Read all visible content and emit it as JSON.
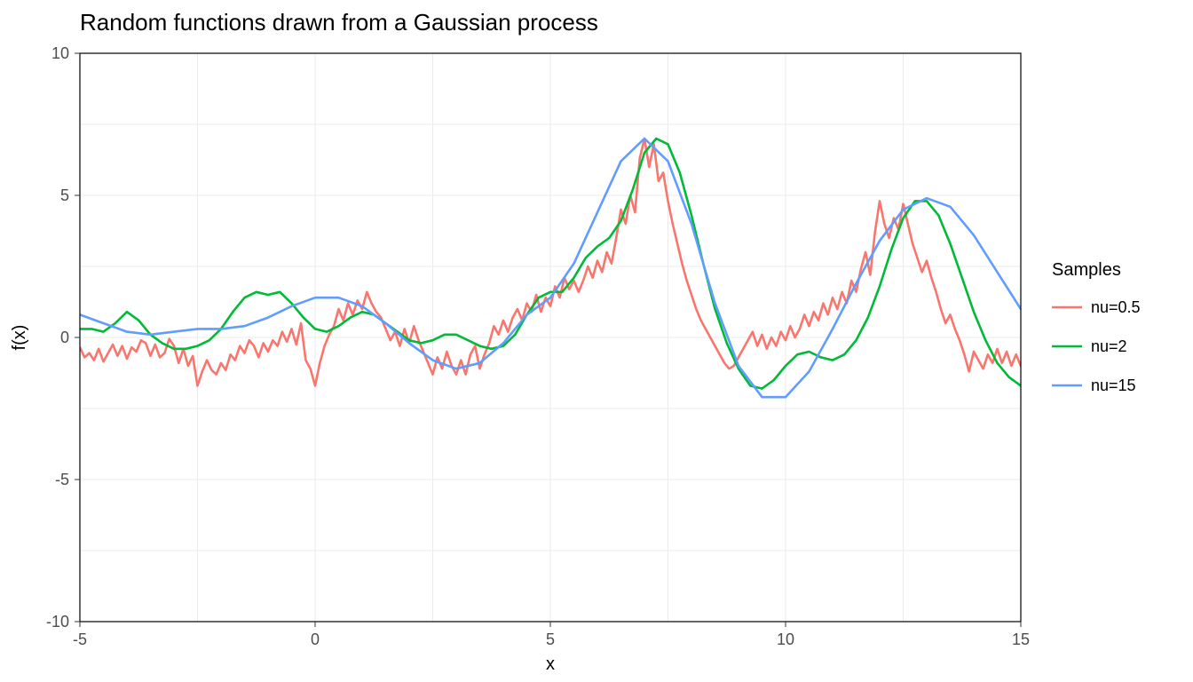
{
  "chart_data": {
    "type": "line",
    "title": "Random functions drawn from a Gaussian process",
    "xlabel": "x",
    "ylabel": "f(x)",
    "xlim": [
      -5,
      15
    ],
    "ylim": [
      -10,
      10
    ],
    "x_ticks": [
      -5,
      0,
      5,
      10,
      15
    ],
    "y_ticks": [
      -10,
      -5,
      0,
      5,
      10
    ],
    "x_grid": [
      -5,
      -2.5,
      0,
      2.5,
      5,
      7.5,
      10,
      12.5,
      15
    ],
    "y_grid": [
      -10,
      -7.5,
      -5,
      -2.5,
      0,
      2.5,
      5,
      7.5,
      10
    ],
    "legend": {
      "title": "Samples",
      "entries": [
        "nu=0.5",
        "nu=2",
        "nu=15"
      ],
      "colors": [
        "#F8766D",
        "#00BA38",
        "#619CFF"
      ]
    },
    "series": [
      {
        "name": "nu=0.5",
        "color": "#F8766D",
        "x": [
          -5.0,
          -4.9,
          -4.8,
          -4.7,
          -4.6,
          -4.5,
          -4.4,
          -4.3,
          -4.2,
          -4.1,
          -4.0,
          -3.9,
          -3.8,
          -3.7,
          -3.6,
          -3.5,
          -3.4,
          -3.3,
          -3.2,
          -3.1,
          -3.0,
          -2.9,
          -2.8,
          -2.7,
          -2.6,
          -2.5,
          -2.4,
          -2.3,
          -2.2,
          -2.1,
          -2.0,
          -1.9,
          -1.8,
          -1.7,
          -1.6,
          -1.5,
          -1.4,
          -1.3,
          -1.2,
          -1.1,
          -1.0,
          -0.9,
          -0.8,
          -0.7,
          -0.6,
          -0.5,
          -0.4,
          -0.3,
          -0.2,
          -0.1,
          0.0,
          0.1,
          0.2,
          0.3,
          0.4,
          0.5,
          0.6,
          0.7,
          0.8,
          0.9,
          1.0,
          1.1,
          1.2,
          1.3,
          1.4,
          1.5,
          1.6,
          1.7,
          1.8,
          1.9,
          2.0,
          2.1,
          2.2,
          2.3,
          2.4,
          2.5,
          2.6,
          2.7,
          2.8,
          2.9,
          3.0,
          3.1,
          3.2,
          3.3,
          3.4,
          3.5,
          3.6,
          3.7,
          3.8,
          3.9,
          4.0,
          4.1,
          4.2,
          4.3,
          4.4,
          4.5,
          4.6,
          4.7,
          4.8,
          4.9,
          5.0,
          5.1,
          5.2,
          5.3,
          5.4,
          5.5,
          5.6,
          5.7,
          5.8,
          5.9,
          6.0,
          6.1,
          6.2,
          6.3,
          6.4,
          6.5,
          6.6,
          6.7,
          6.8,
          6.9,
          7.0,
          7.1,
          7.2,
          7.3,
          7.4,
          7.5,
          7.6,
          7.7,
          7.8,
          7.9,
          8.0,
          8.1,
          8.2,
          8.3,
          8.4,
          8.5,
          8.6,
          8.7,
          8.8,
          8.9,
          9.0,
          9.1,
          9.2,
          9.3,
          9.4,
          9.5,
          9.6,
          9.7,
          9.8,
          9.9,
          10.0,
          10.1,
          10.2,
          10.3,
          10.4,
          10.5,
          10.6,
          10.7,
          10.8,
          10.9,
          11.0,
          11.1,
          11.2,
          11.3,
          11.4,
          11.5,
          11.6,
          11.7,
          11.8,
          11.9,
          12.0,
          12.1,
          12.2,
          12.3,
          12.4,
          12.5,
          12.6,
          12.7,
          12.8,
          12.9,
          13.0,
          13.1,
          13.2,
          13.3,
          13.4,
          13.5,
          13.6,
          13.7,
          13.8,
          13.9,
          14.0,
          14.1,
          14.2,
          14.3,
          14.4,
          14.5,
          14.6,
          14.7,
          14.8,
          14.9,
          15.0
        ],
        "y": [
          -0.35,
          -0.7,
          -0.55,
          -0.8,
          -0.4,
          -0.85,
          -0.55,
          -0.25,
          -0.65,
          -0.3,
          -0.75,
          -0.35,
          -0.5,
          -0.1,
          -0.2,
          -0.65,
          -0.25,
          -0.7,
          -0.55,
          -0.05,
          -0.3,
          -0.9,
          -0.4,
          -1.0,
          -0.65,
          -1.7,
          -1.2,
          -0.8,
          -1.15,
          -1.3,
          -0.9,
          -1.15,
          -0.6,
          -0.8,
          -0.3,
          -0.55,
          -0.1,
          -0.3,
          -0.7,
          -0.2,
          -0.5,
          -0.1,
          -0.3,
          0.2,
          -0.15,
          0.3,
          -0.25,
          0.5,
          -0.8,
          -1.1,
          -1.7,
          -0.9,
          -0.3,
          0.1,
          0.4,
          1.0,
          0.6,
          1.2,
          0.8,
          1.3,
          1.0,
          1.6,
          1.2,
          0.9,
          0.7,
          0.3,
          -0.1,
          0.2,
          -0.3,
          0.3,
          -0.2,
          0.4,
          -0.1,
          -0.5,
          -0.9,
          -1.3,
          -0.7,
          -1.1,
          -0.5,
          -1.0,
          -1.3,
          -0.8,
          -1.3,
          -0.6,
          -0.3,
          -1.1,
          -0.6,
          -0.2,
          0.4,
          0.1,
          0.6,
          0.2,
          0.7,
          1.0,
          0.6,
          1.2,
          0.9,
          1.5,
          0.9,
          1.4,
          1.1,
          1.8,
          1.4,
          2.1,
          1.7,
          2.0,
          1.6,
          2.0,
          2.5,
          2.1,
          2.7,
          2.3,
          3.0,
          2.6,
          3.5,
          4.5,
          4.0,
          5.0,
          4.4,
          6.3,
          7.0,
          6.0,
          6.8,
          5.5,
          5.8,
          4.8,
          4.0,
          3.3,
          2.6,
          2.0,
          1.5,
          1.0,
          0.6,
          0.3,
          0.0,
          -0.3,
          -0.6,
          -0.9,
          -1.1,
          -1.0,
          -0.7,
          -0.4,
          -0.1,
          0.2,
          -0.3,
          0.1,
          -0.4,
          0.0,
          -0.3,
          0.2,
          -0.1,
          0.4,
          0.0,
          0.3,
          0.8,
          0.4,
          0.9,
          0.6,
          1.2,
          0.8,
          1.4,
          1.0,
          1.6,
          1.2,
          2.0,
          1.6,
          2.4,
          3.0,
          2.2,
          3.7,
          4.8,
          4.0,
          3.5,
          4.2,
          3.8,
          4.7,
          4.0,
          3.3,
          2.8,
          2.3,
          2.7,
          2.1,
          1.6,
          1.0,
          0.5,
          0.8,
          0.3,
          -0.1,
          -0.6,
          -1.2,
          -0.5,
          -0.8,
          -1.1,
          -0.6,
          -0.9,
          -0.4,
          -0.9,
          -0.5,
          -1.0,
          -0.6,
          -1.0
        ]
      },
      {
        "name": "nu=2",
        "color": "#00BA38",
        "x": [
          -5.0,
          -4.75,
          -4.5,
          -4.25,
          -4.0,
          -3.75,
          -3.5,
          -3.25,
          -3.0,
          -2.75,
          -2.5,
          -2.25,
          -2.0,
          -1.75,
          -1.5,
          -1.25,
          -1.0,
          -0.75,
          -0.5,
          -0.25,
          0.0,
          0.25,
          0.5,
          0.75,
          1.0,
          1.25,
          1.5,
          1.75,
          2.0,
          2.25,
          2.5,
          2.75,
          3.0,
          3.25,
          3.5,
          3.75,
          4.0,
          4.25,
          4.5,
          4.75,
          5.0,
          5.25,
          5.5,
          5.75,
          6.0,
          6.25,
          6.5,
          6.75,
          7.0,
          7.25,
          7.5,
          7.75,
          8.0,
          8.25,
          8.5,
          8.75,
          9.0,
          9.25,
          9.5,
          9.75,
          10.0,
          10.25,
          10.5,
          10.75,
          11.0,
          11.25,
          11.5,
          11.75,
          12.0,
          12.25,
          12.5,
          12.75,
          13.0,
          13.25,
          13.5,
          13.75,
          14.0,
          14.25,
          14.5,
          14.75,
          15.0
        ],
        "y": [
          0.3,
          0.3,
          0.2,
          0.5,
          0.9,
          0.6,
          0.1,
          -0.2,
          -0.4,
          -0.4,
          -0.3,
          -0.1,
          0.3,
          0.9,
          1.4,
          1.6,
          1.5,
          1.6,
          1.2,
          0.7,
          0.3,
          0.2,
          0.4,
          0.7,
          0.9,
          0.8,
          0.5,
          0.2,
          -0.1,
          -0.2,
          -0.1,
          0.1,
          0.1,
          -0.1,
          -0.3,
          -0.4,
          -0.3,
          0.1,
          0.8,
          1.4,
          1.6,
          1.6,
          2.1,
          2.8,
          3.2,
          3.5,
          4.1,
          5.2,
          6.5,
          7.0,
          6.8,
          5.8,
          4.3,
          2.6,
          1.0,
          -0.2,
          -1.1,
          -1.7,
          -1.8,
          -1.5,
          -1.0,
          -0.6,
          -0.5,
          -0.7,
          -0.8,
          -0.6,
          -0.1,
          0.7,
          1.8,
          3.1,
          4.2,
          4.8,
          4.8,
          4.3,
          3.3,
          2.1,
          0.9,
          -0.1,
          -0.9,
          -1.4,
          -1.7
        ]
      },
      {
        "name": "nu=15",
        "color": "#619CFF",
        "x": [
          -5.0,
          -4.5,
          -4.0,
          -3.5,
          -3.0,
          -2.5,
          -2.0,
          -1.5,
          -1.0,
          -0.5,
          0.0,
          0.5,
          1.0,
          1.5,
          2.0,
          2.5,
          3.0,
          3.5,
          4.0,
          4.5,
          5.0,
          5.5,
          6.0,
          6.5,
          7.0,
          7.5,
          8.0,
          8.5,
          9.0,
          9.5,
          10.0,
          10.5,
          11.0,
          11.5,
          12.0,
          12.5,
          13.0,
          13.5,
          14.0,
          14.5,
          15.0
        ],
        "y": [
          0.8,
          0.5,
          0.2,
          0.1,
          0.2,
          0.3,
          0.3,
          0.4,
          0.7,
          1.1,
          1.4,
          1.4,
          1.1,
          0.5,
          -0.2,
          -0.8,
          -1.1,
          -0.9,
          -0.2,
          0.8,
          1.4,
          2.6,
          4.4,
          6.2,
          7.0,
          6.2,
          4.0,
          1.2,
          -1.0,
          -2.1,
          -2.1,
          -1.2,
          0.3,
          1.9,
          3.4,
          4.5,
          4.9,
          4.6,
          3.6,
          2.3,
          1.0
        ]
      }
    ]
  }
}
